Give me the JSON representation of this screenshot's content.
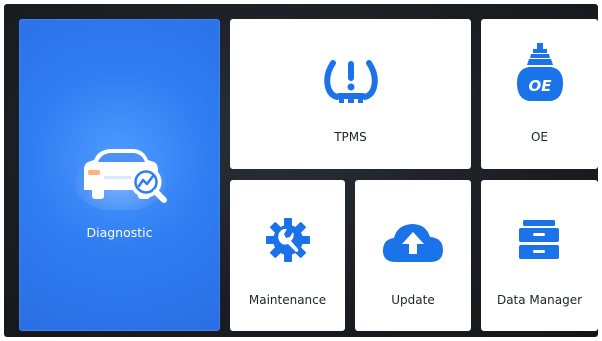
{
  "tiles": {
    "diagnostic": {
      "label": "Diagnostic",
      "icon": "car-diagnostic-icon"
    },
    "tpms": {
      "label": "TPMS",
      "icon": "tire-pressure-warning-icon"
    },
    "oe": {
      "label": "OE",
      "icon": "oe-sensor-icon"
    },
    "maintenance": {
      "label": "Maintenance",
      "icon": "gear-wrench-icon"
    },
    "update": {
      "label": "Update",
      "icon": "cloud-upload-icon"
    },
    "data_manager": {
      "label": "Data Manager",
      "icon": "storage-drawers-icon"
    }
  },
  "colors": {
    "accent": "#1a73e8",
    "diagnostic_tile": "#2f7df2",
    "background": "#1a1d22",
    "tile": "#ffffff",
    "text": "#1f2328"
  }
}
